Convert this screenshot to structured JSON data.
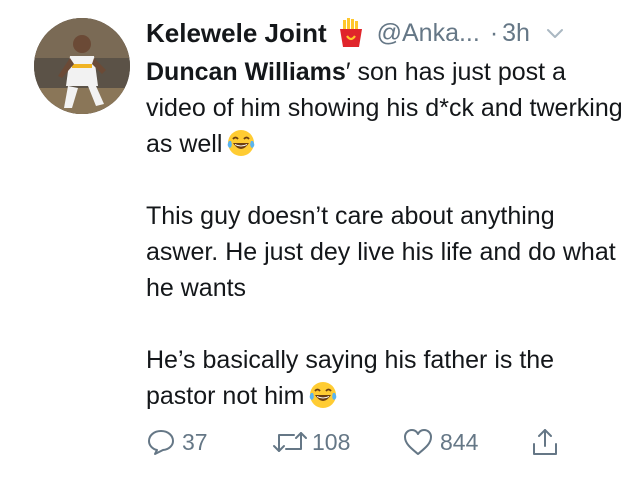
{
  "tweet": {
    "display_name": "Kelewele Joint",
    "badge_icon": "fries-icon",
    "handle": "@Anka...",
    "separator": "·",
    "time": "3h",
    "mention": "Duncan Williams",
    "line1_rest": "′ son has just post a video of him showing his d*ck and twerking as well",
    "paragraph2": "This guy doesn’t care about anything aswer. He just dey live his life and do what he wants",
    "paragraph3": "He’s basically saying his father is the pastor not him",
    "emoji": "laughing-tears-emoji"
  },
  "actions": {
    "reply_count": "37",
    "retweet_count": "108",
    "like_count": "844"
  },
  "colors": {
    "text": "#14171a",
    "muted": "#657786",
    "badge_red": "#e0252b",
    "badge_yellow": "#ffc72c"
  }
}
